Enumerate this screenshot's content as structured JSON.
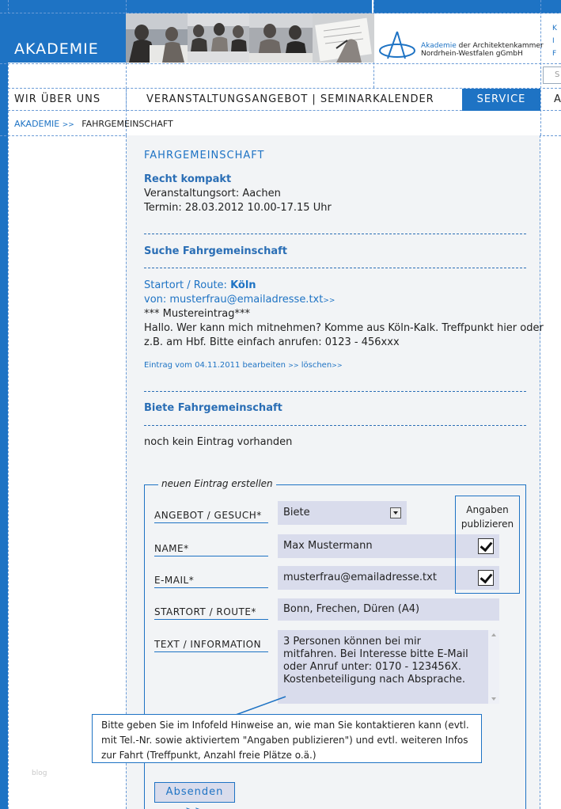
{
  "header": {
    "logo": "AKADEMIE",
    "brand_highlight": "Akademie",
    "brand_line1_rest": " der Architektenkammer",
    "brand_line2": "Nordrhein-Westfalen gGmbH",
    "right_links": [
      "K",
      "I",
      "F"
    ],
    "search_placeholder": "S"
  },
  "nav": {
    "items": [
      "WIR ÜBER UNS",
      "VERANSTALTUNGSANGEBOT | SEMINARKALENDER",
      "SERVICE",
      "A"
    ]
  },
  "breadcrumb": {
    "home": "AKADEMIE",
    "arrow": ">>",
    "current": "FAHRGEMEINSCHAFT"
  },
  "page": {
    "title": "FAHRGEMEINSCHAFT",
    "event": {
      "name": "Recht kompakt",
      "location": "Veranstaltungsort: Aachen",
      "date": "Termin: 28.03.2012 10.00-17.15 Uhr"
    },
    "search_section": {
      "heading": "Suche Fahrgemeinschaft",
      "entry": {
        "route_label": "Startort / Route:",
        "route_value": "Köln",
        "from_label": "von: musterfrau@emailadresse.txt",
        "from_arrow": ">>",
        "sample": "*** Mustereintrag***",
        "text_line1": "Hallo. Wer kann mich mitnehmen? Komme aus Köln-Kalk. Treffpunkt hier oder",
        "text_line2": "z.B. am Hbf. Bitte einfach anrufen: 0123 - 456xxx",
        "meta": "Eintrag vom 04.11.2011 bearbeiten",
        "meta_arrow1": ">>",
        "delete": "löschen",
        "meta_arrow2": ">>"
      }
    },
    "offer_section": {
      "heading": "Biete Fahrgemeinschaft",
      "empty": "noch kein Eintrag vorhanden"
    }
  },
  "form": {
    "legend": "neuen Eintrag erstellen",
    "publish_label_line1": "Angaben",
    "publish_label_line2": "publizieren",
    "fields": {
      "type_label": "ANGEBOT / GESUCH*",
      "type_value": "Biete",
      "name_label": "NAME*",
      "name_value": "Max Mustermann",
      "email_label": "E-MAIL*",
      "email_value": "musterfrau@emailadresse.txt",
      "route_label": "STARTORT / ROUTE*",
      "route_value": "Bonn, Frechen, Düren (A4)",
      "text_label": "TEXT / INFORMATION",
      "text_lines": [
        "3 Personen können bei mir",
        "mitfahren. Bei Interesse bitte E-Mail",
        "oder Anruf unter: 0170 - 123456X.",
        "Kostenbeteiligung nach Absprache."
      ]
    },
    "hint_lines": [
      "Bitte geben Sie im Infofeld Hinweise an, wie man Sie kontaktieren kann (evtl.",
      "mit Tel.-Nr. sowie aktiviertem \"Angaben publizieren\") und evtl. weiteren Infos",
      "zur Fahrt (Treffpunkt, Anzahl freie Plätze o.ä.)"
    ],
    "submit": "Absenden >>"
  },
  "watermark": "blog",
  "colors": {
    "accent": "#1e73c4",
    "field_bg": "#d9dcec",
    "content_bg": "#f2f4f6"
  }
}
